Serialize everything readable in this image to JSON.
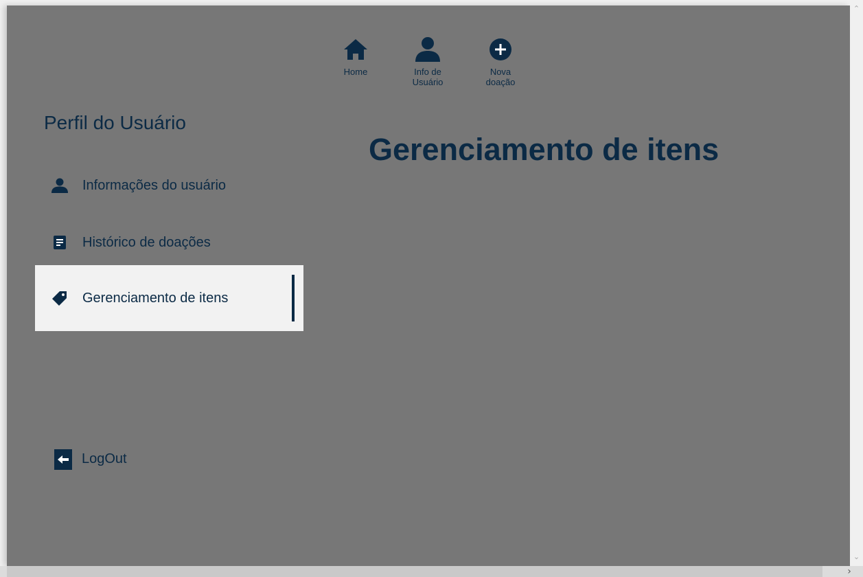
{
  "topnav": {
    "items": [
      {
        "icon": "home-icon",
        "label": "Home"
      },
      {
        "icon": "user-icon",
        "label": "Info de\nUsuário"
      },
      {
        "icon": "plus-circle-icon",
        "label": "Nova\ndoação"
      }
    ]
  },
  "sidebar": {
    "title": "Perfil do Usuário",
    "items": [
      {
        "icon": "user-icon",
        "label": "Informações do usuário",
        "active": false
      },
      {
        "icon": "document-icon",
        "label": "Histórico de doações",
        "active": false
      },
      {
        "icon": "tag-icon",
        "label": "Gerenciamento de itens",
        "active": true
      }
    ],
    "logout": {
      "icon": "logout-icon",
      "label": "LogOut"
    }
  },
  "main": {
    "title": "Gerenciamento de itens"
  },
  "colors": {
    "background": "#777777",
    "primary": "#0b2a45",
    "active_item_bg": "#f2f2f2"
  }
}
